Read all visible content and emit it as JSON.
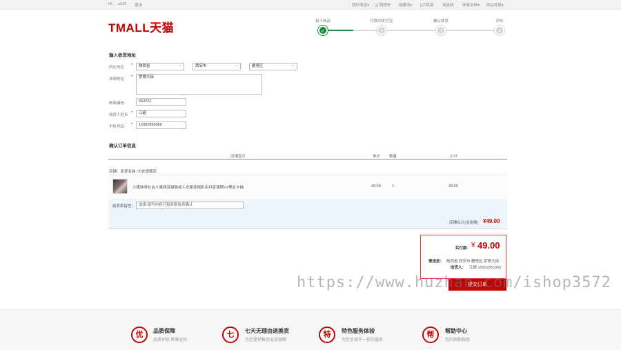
{
  "topbar": {
    "greeting": "Hi,",
    "username": "a120",
    "logout": "退出",
    "my_taobao": "我的淘宝",
    "my_taobao_caret": "▾",
    "cart": "购物车",
    "favorites": "收藏夹",
    "favorites_caret": "▾",
    "mobile": "手机版",
    "taobao": "淘宝网",
    "merchant": "商家支持",
    "merchant_caret": "▾",
    "sitemap": "网站导航",
    "sitemap_caret": "▾"
  },
  "logo": {
    "text": "TMALL天猫"
  },
  "steps": [
    {
      "label": "拍下商品",
      "num": "✓",
      "active": true
    },
    {
      "label": "付款到支付宝",
      "num": "2",
      "active": false
    },
    {
      "label": "确认收货",
      "num": "3",
      "active": false
    },
    {
      "label": "评价",
      "num": "4",
      "active": false
    }
  ],
  "address": {
    "title": "输入收货地址",
    "region_label": "所在地区",
    "province": "陕西省",
    "city": "西安市",
    "district": "雁塔区",
    "detail_label": "详细地址",
    "detail_value": "梦想大街",
    "zip_label": "邮政编码",
    "zip_value": "652222",
    "name_label": "收货人姓名",
    "name_value": "江超",
    "phone_label": "手机号码",
    "phone_value": "15902955069",
    "required_mark": "*"
  },
  "order": {
    "title": "确认订单信息",
    "headers": {
      "item": "店铺宝贝",
      "price": "单价",
      "qty": "数量",
      "subtotal": "小计"
    },
    "shop_label": "店铺：",
    "shop_name": "民爱女装 /大衣旗舰店",
    "item": {
      "name": "小猪妹身社会人羹两耳猫猫成人衣服连裙影名抖音潮牌ins黑女卡袖",
      "price": "49.00",
      "qty": "1",
      "subtotal": "49.00"
    },
    "note_label": "给卖家留言：",
    "note_placeholder": "选填:填写内容已和卖家协商确认",
    "shop_total_label": "店铺合计(运送费)",
    "shop_total_value": "¥49.00"
  },
  "summary": {
    "paid_label": "实付款：",
    "currency": "¥",
    "paid_value": "49.00",
    "ship_to_label": "寄送至：",
    "ship_to_value": "陕西省 西安市 雁塔区 梦想大街",
    "receiver_label": "收货人：",
    "receiver_value": "江超 15902955069",
    "submit": "提交订单"
  },
  "watermark": "https://www.huzhan.com/ishop3572",
  "footer": [
    {
      "icon": "优",
      "title": "品质保障",
      "sub": "品质护航 购物无忧"
    },
    {
      "icon": "七",
      "title": "七天无理由退换货",
      "sub": "为您提供售后无忧保障"
    },
    {
      "icon": "特",
      "title": "特色服务体验",
      "sub": "为您呈现不一样的服务"
    },
    {
      "icon": "帮",
      "title": "帮助中心",
      "sub": "您的购物指南"
    }
  ],
  "colors": {
    "brand": "#c40000",
    "step_active": "#1a8a3c",
    "table_line": "#b6c8de"
  }
}
